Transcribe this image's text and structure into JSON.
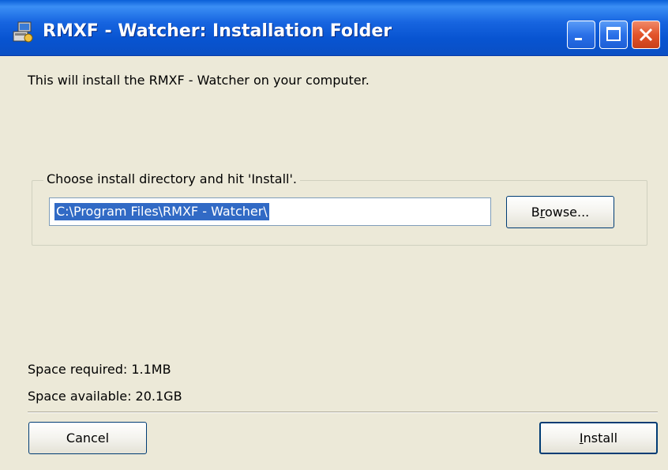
{
  "window": {
    "title": "RMXF - Watcher: Installation Folder",
    "icon": "installer-app-icon",
    "controls": {
      "minimize_icon": "minimize-icon",
      "maximize_icon": "maximize-icon",
      "close_icon": "close-icon"
    }
  },
  "description": "This will install the RMXF - Watcher on your computer.",
  "directory_group": {
    "legend": "Choose install directory and hit 'Install'.",
    "path_value": "C:\\Program Files\\RMXF - Watcher\\",
    "browse_label_pre": "B",
    "browse_label_accel": "r",
    "browse_label_post": "owse..."
  },
  "space": {
    "required": "Space required: 1.1MB",
    "available": "Space available: 20.1GB"
  },
  "buttons": {
    "cancel_label": "Cancel",
    "install_accel": "I",
    "install_rest": "nstall"
  },
  "colors": {
    "titlebar": "#0a5fd8",
    "dialog_bg": "#ece9d8",
    "selection": "#316ac5",
    "close_button": "#e2542a"
  }
}
